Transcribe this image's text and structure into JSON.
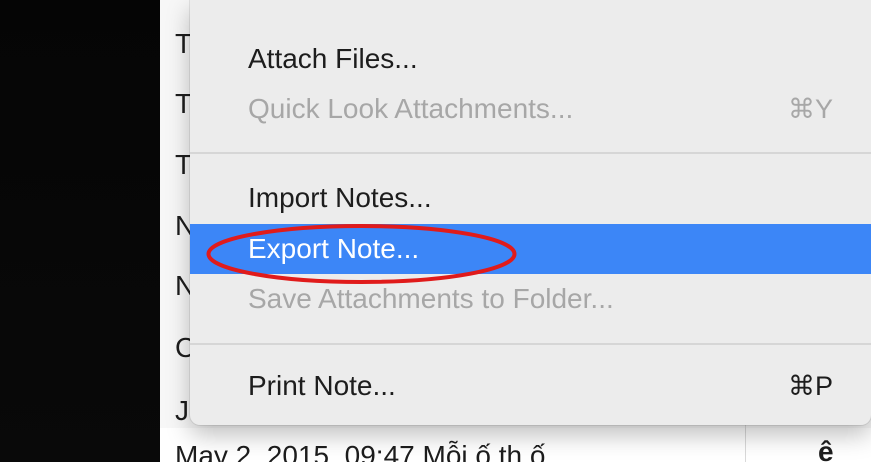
{
  "menu": {
    "items": [
      {
        "label": "Attach Files...",
        "shortcut": "",
        "enabled": true
      },
      {
        "label": "Quick Look Attachments...",
        "shortcut": "⌘Y",
        "enabled": false
      },
      {
        "label": "Import Notes...",
        "shortcut": "",
        "enabled": true
      },
      {
        "label": "Export Note...",
        "shortcut": "",
        "enabled": true,
        "highlighted": true
      },
      {
        "label": "Save Attachments to Folder...",
        "shortcut": "",
        "enabled": false
      },
      {
        "label": "Print Note...",
        "shortcut": "⌘P",
        "enabled": true
      }
    ]
  },
  "background_list": {
    "letters": [
      "T",
      "T",
      "T",
      "N",
      "N",
      "C",
      "J"
    ],
    "bottom_row_text": "May 2, 2015, 09:47         Mỗi ố th ố",
    "bottom_right_text": "ê"
  },
  "colors": {
    "highlight": "#3c86f7",
    "annotation_circle": "#e01b1b"
  }
}
